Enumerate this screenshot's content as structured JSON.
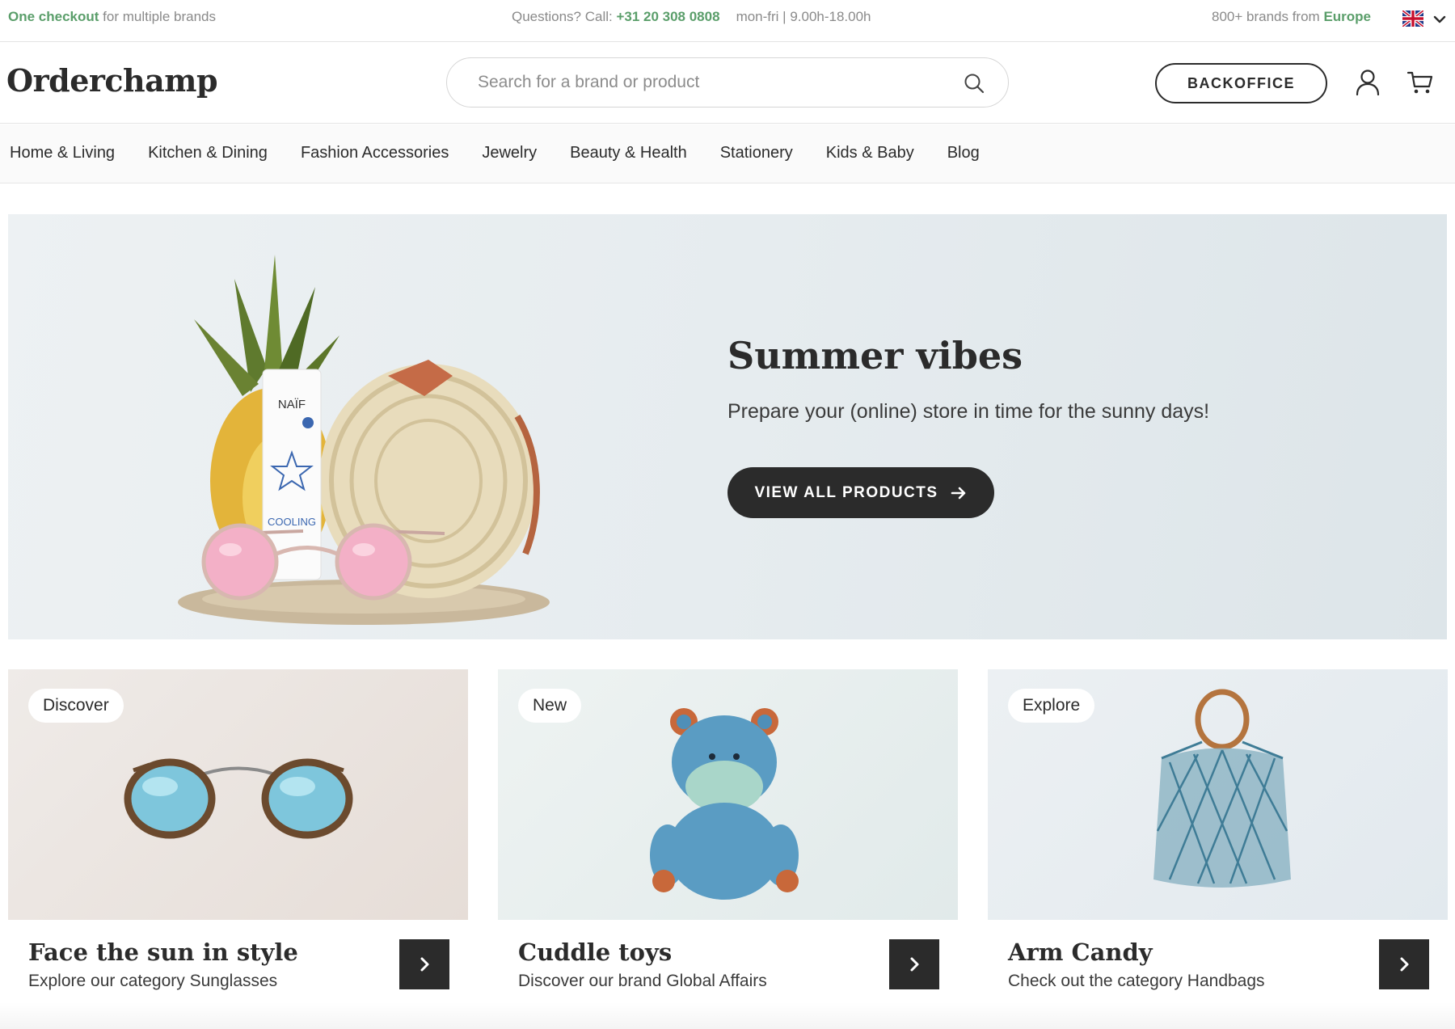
{
  "topbar": {
    "promo_bold": "One checkout",
    "promo_rest": " for multiple brands",
    "call_label": "Questions? Call: ",
    "phone": "+31 20 308 0808",
    "hours": "mon-fri | 9.00h-18.00h",
    "brands_rest": "800+ brands from ",
    "brands_region": "Europe",
    "language_icon": "uk-flag-icon"
  },
  "header": {
    "logo": "Orderchamp",
    "search_placeholder": "Search for a brand or product",
    "backoffice_label": "BACKOFFICE"
  },
  "nav": {
    "items": [
      "Home & Living",
      "Kitchen & Dining",
      "Fashion Accessories",
      "Jewelry",
      "Beauty & Health",
      "Stationery",
      "Kids & Baby",
      "Blog"
    ]
  },
  "hero": {
    "title": "Summer vibes",
    "subtitle": "Prepare your (online) store in time for the sunny days!",
    "cta": "VIEW ALL PRODUCTS",
    "tube_brand": "NAÏF",
    "tube_text": "COOLING"
  },
  "cards": [
    {
      "badge": "Discover",
      "title": "Face the sun in style",
      "subtitle": "Explore our category Sunglasses"
    },
    {
      "badge": "New",
      "title": "Cuddle toys",
      "subtitle": "Discover our brand Global Affairs"
    },
    {
      "badge": "Explore",
      "title": "Arm Candy",
      "subtitle": "Check out the category Handbags"
    }
  ],
  "colors": {
    "accent_green": "#5a9e6a",
    "dark": "#2b2b2b"
  }
}
